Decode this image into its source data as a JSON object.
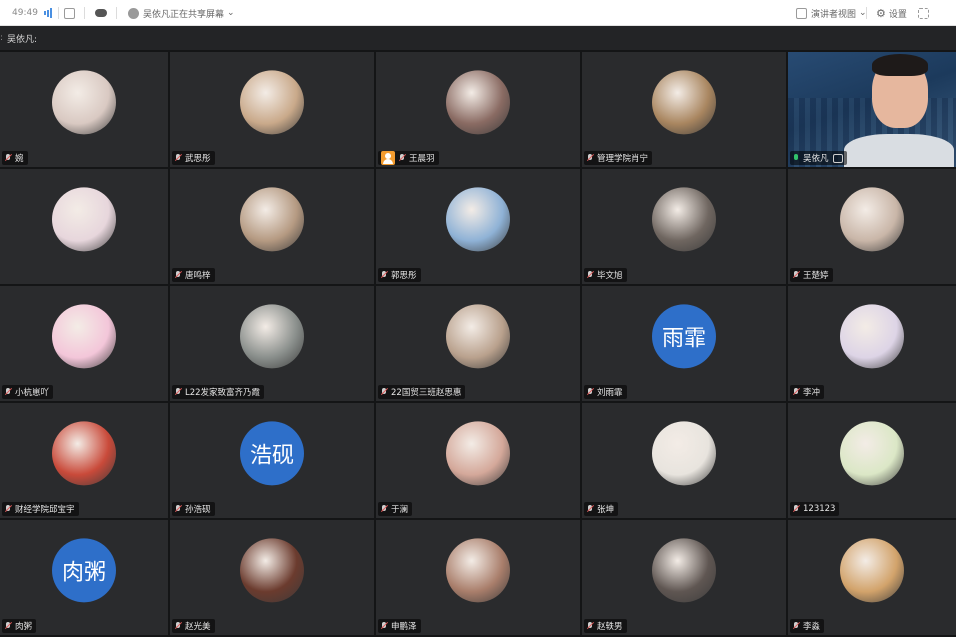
{
  "topbar": {
    "timer": "49:49",
    "sharing_text": "吴依凡正在共享屏幕",
    "view_mode_label": "演讲者视图",
    "settings_label": "设置"
  },
  "titlebar": {
    "speaker_label": "吴依凡:"
  },
  "colors": {
    "active_outline": "#2ad07f",
    "avatar_text_bg": "#2e6fc9",
    "user_badge": "#f29b2f"
  },
  "participants": [
    {
      "name": "婉",
      "avatar": "photo",
      "color": "#d9c9c2"
    },
    {
      "name": "武思彤",
      "avatar": "photo",
      "color": "#c9a98a"
    },
    {
      "name": "王晨羽",
      "avatar": "photo",
      "color": "#8a6b63",
      "badge": "user"
    },
    {
      "name": "管理学院肖宁",
      "avatar": "photo",
      "color": "#a98660"
    },
    {
      "name": "吴依凡",
      "avatar": "video",
      "active": true,
      "host": true
    },
    {
      "name": "",
      "avatar": "photo",
      "color": "#e7d6dc"
    },
    {
      "name": "唐鸣梓",
      "avatar": "photo",
      "color": "#b59a82"
    },
    {
      "name": "郭思彤",
      "avatar": "photo",
      "color": "#8fb2d6"
    },
    {
      "name": "毕文旭",
      "avatar": "photo",
      "color": "#6f6660"
    },
    {
      "name": "王楚婷",
      "avatar": "photo",
      "color": "#c9b6a8"
    },
    {
      "name": "小杭崽吖",
      "avatar": "photo",
      "color": "#f3c6d9"
    },
    {
      "name": "L22发家致富齐乃霞",
      "avatar": "photo",
      "color": "#8a8f8c"
    },
    {
      "name": "22国贸三班赵思惠",
      "avatar": "photo",
      "color": "#b9a18d"
    },
    {
      "name": "刘雨霏",
      "avatar": "text",
      "text": "雨霏"
    },
    {
      "name": "李冲",
      "avatar": "photo",
      "color": "#ddd4e6"
    },
    {
      "name": "财经学院邱宝宇",
      "avatar": "photo",
      "color": "#c94a3a"
    },
    {
      "name": "孙浩砚",
      "avatar": "text",
      "text": "浩砚"
    },
    {
      "name": "于澜",
      "avatar": "photo",
      "color": "#d4a89a"
    },
    {
      "name": "张坤",
      "avatar": "photo",
      "color": "#e8e4de"
    },
    {
      "name": "123123",
      "avatar": "photo",
      "color": "#dbe7c6"
    },
    {
      "name": "肉粥",
      "avatar": "text",
      "text": "肉粥"
    },
    {
      "name": "赵光美",
      "avatar": "photo",
      "color": "#6b3b2e"
    },
    {
      "name": "申鹏泽",
      "avatar": "photo",
      "color": "#a97e6b"
    },
    {
      "name": "赵轶男",
      "avatar": "photo",
      "color": "#5f5652"
    },
    {
      "name": "李淼",
      "avatar": "photo",
      "color": "#d2a36b"
    }
  ]
}
